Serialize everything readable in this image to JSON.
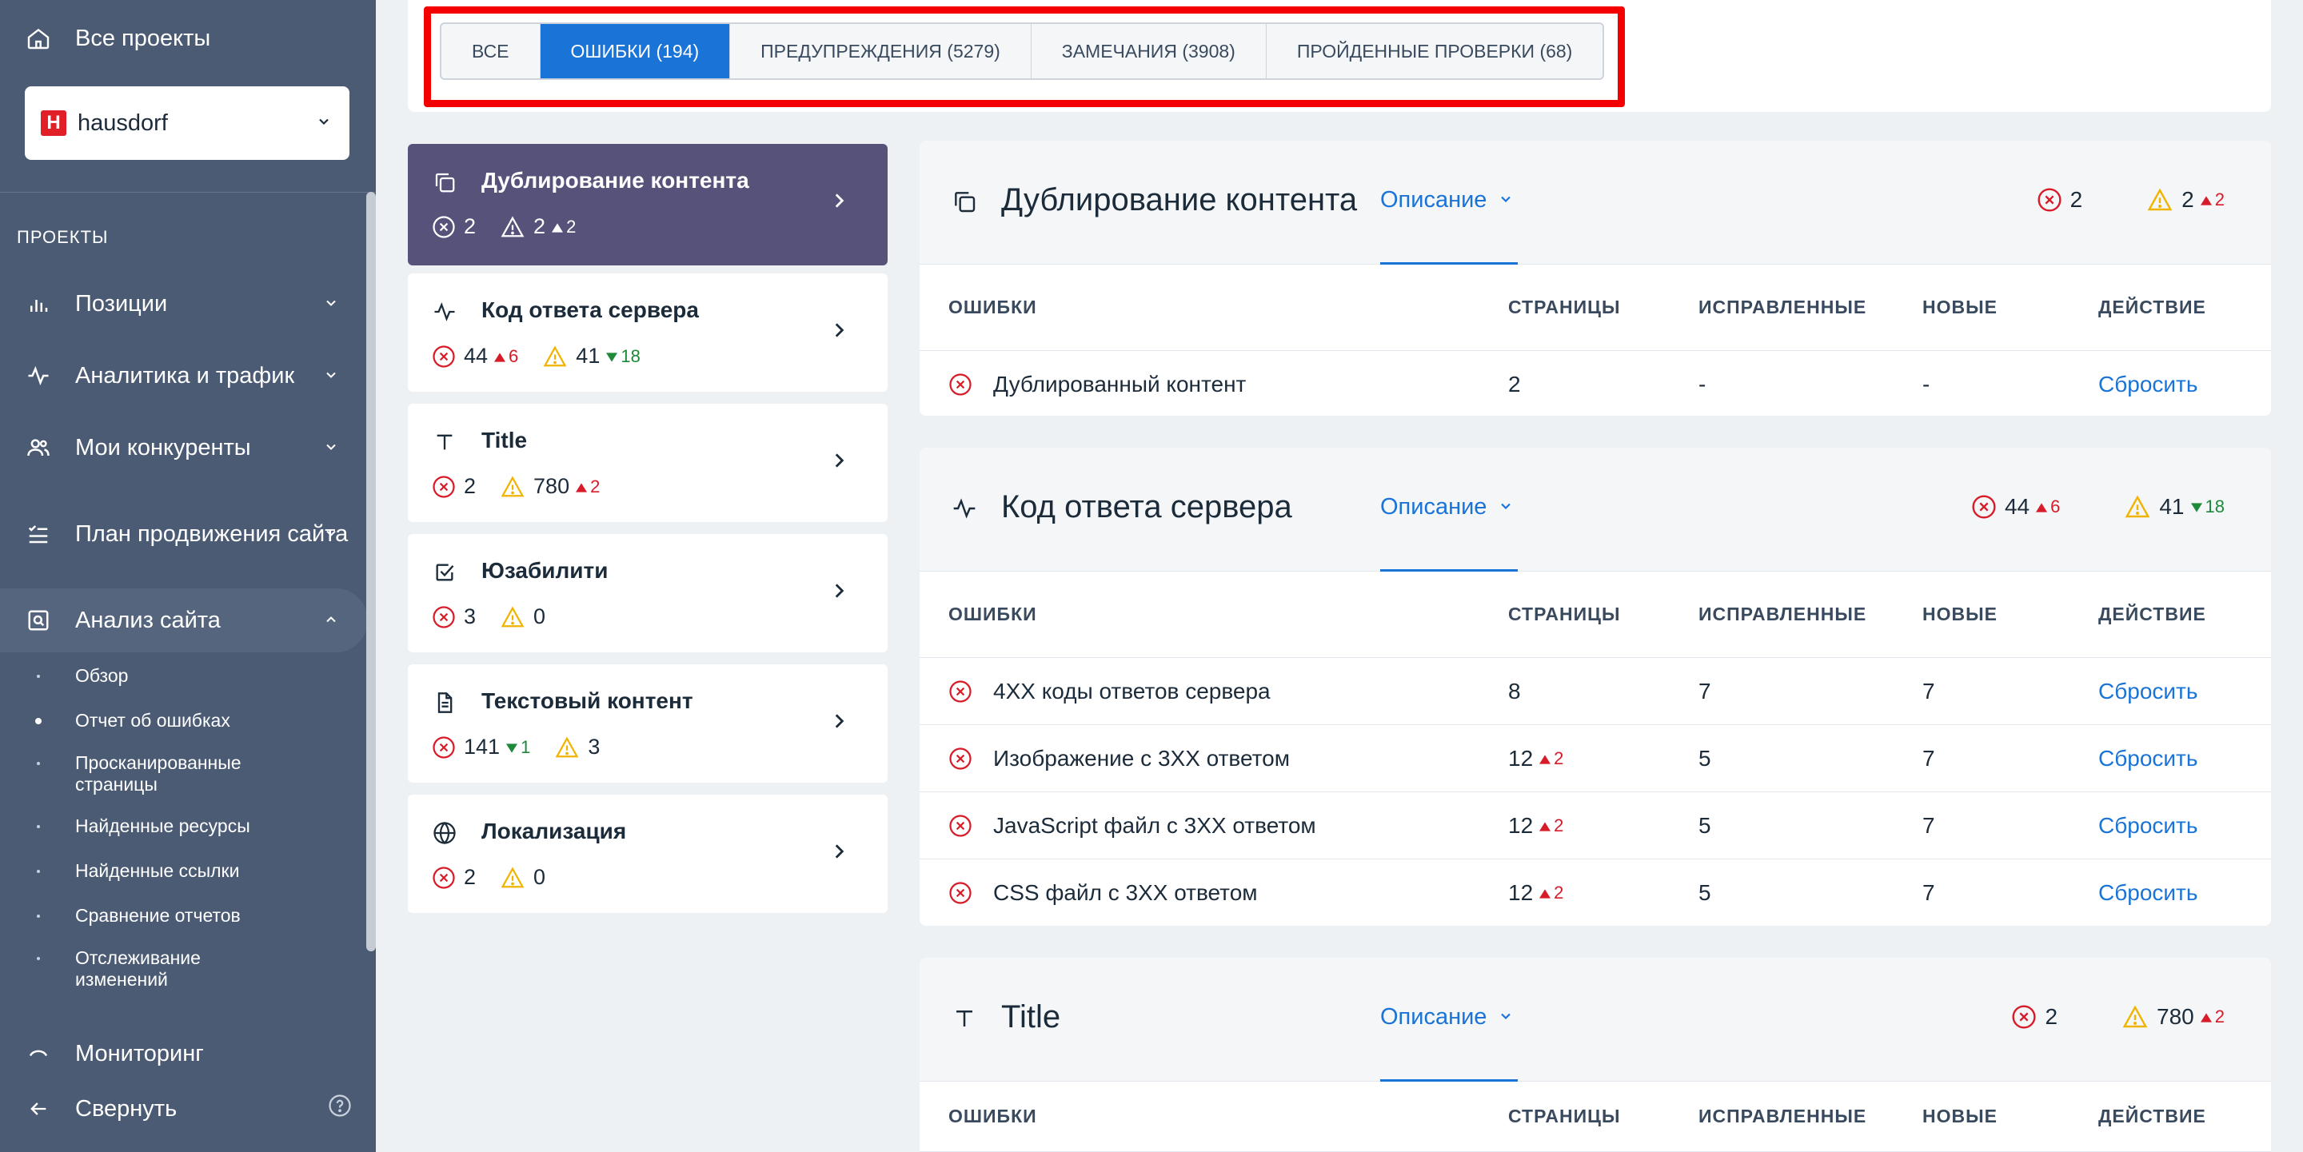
{
  "sidebar": {
    "all_projects": "Все проекты",
    "project": {
      "logo": "H",
      "name": "hausdorf"
    },
    "section_label": "ПРОЕКТЫ",
    "nav": [
      {
        "label": "Позиции",
        "icon": "bar-chart-icon"
      },
      {
        "label": "Аналитика и трафик",
        "icon": "pulse-icon"
      },
      {
        "label": "Мои конкуренты",
        "icon": "users-icon"
      },
      {
        "label": "План продвижения сайта",
        "icon": "checklist-icon"
      },
      {
        "label": "Анализ сайта",
        "icon": "site-audit-icon"
      }
    ],
    "sub_items": [
      "Обзор",
      "Отчет об ошибках",
      "Просканированные страницы",
      "Найденные ресурсы",
      "Найденные ссылки",
      "Сравнение отчетов",
      "Отслеживание изменений"
    ],
    "monitoring": "Мониторинг",
    "collapse": "Свернуть"
  },
  "tabs": [
    {
      "label": "ВСЕ"
    },
    {
      "label": "ОШИБКИ (194)"
    },
    {
      "label": "ПРЕДУПРЕЖДЕНИЯ (5279)"
    },
    {
      "label": "ЗАМЕЧАНИЯ (3908)"
    },
    {
      "label": "ПРОЙДЕННЫЕ ПРОВЕРКИ (68)"
    }
  ],
  "categories": [
    {
      "title": "Дублирование контента",
      "errors": "2",
      "warnings": "2",
      "warn_delta": "2"
    },
    {
      "title": "Код ответа сервера",
      "errors": "44",
      "err_delta": "6",
      "warnings": "41",
      "warn_delta": "18"
    },
    {
      "title": "Title",
      "errors": "2",
      "warnings": "780",
      "warn_delta": "2"
    },
    {
      "title": "Юзабилити",
      "errors": "3",
      "warnings": "0"
    },
    {
      "title": "Текстовый контент",
      "errors": "141",
      "err_delta": "1",
      "warnings": "3"
    },
    {
      "title": "Локализация",
      "errors": "2",
      "warnings": "0"
    }
  ],
  "table_headers": {
    "errors": "ОШИБКИ",
    "pages": "СТРАНИЦЫ",
    "fixed": "ИСПРАВЛЕННЫЕ",
    "new": "НОВЫЕ",
    "action": "ДЕЙСТВИЕ"
  },
  "description_label": "Описание",
  "panels": [
    {
      "title": "Дублирование контента",
      "errors": "2",
      "warnings": "2",
      "warn_delta": "2",
      "rows": [
        {
          "name": "Дублированный контент",
          "pages": "2",
          "fixed": "-",
          "new": "-",
          "action": "Сбросить"
        }
      ]
    },
    {
      "title": "Код ответа сервера",
      "errors": "44",
      "err_delta": "6",
      "warnings": "41",
      "warn_delta": "18",
      "rows": [
        {
          "name": "4XX коды ответов сервера",
          "pages": "8",
          "fixed": "7",
          "new": "7",
          "action": "Сбросить"
        },
        {
          "name": "Изображение с 3XX ответом",
          "pages": "12",
          "pages_delta": "2",
          "fixed": "5",
          "new": "7",
          "action": "Сбросить"
        },
        {
          "name": "JavaScript файл с 3XX ответом",
          "pages": "12",
          "pages_delta": "2",
          "fixed": "5",
          "new": "7",
          "action": "Сбросить"
        },
        {
          "name": "CSS файл с 3XX ответом",
          "pages": "12",
          "pages_delta": "2",
          "fixed": "5",
          "new": "7",
          "action": "Сбросить"
        }
      ]
    },
    {
      "title": "Title",
      "errors": "2",
      "warnings": "780",
      "warn_delta": "2"
    }
  ],
  "colors": {
    "sidebar_bg": "#4b5b74",
    "accent": "#1a73d6",
    "error": "#d81b28",
    "warning": "#f0b400",
    "positive": "#1d8a3a",
    "active_category": "#57527a",
    "highlight_box": "#f40000"
  }
}
